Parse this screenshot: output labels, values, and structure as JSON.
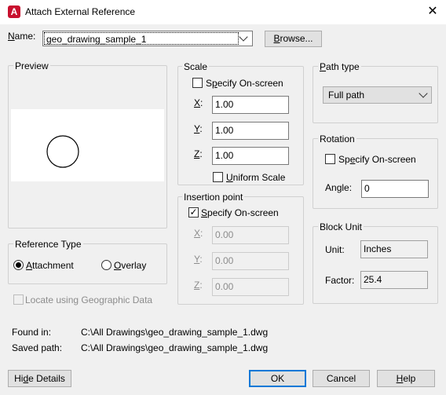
{
  "window": {
    "title": "Attach External Reference",
    "app_icon_letter": "A"
  },
  "name_row": {
    "label": "Name:",
    "value": "geo_drawing_sample_1",
    "browse_label": "Browse..."
  },
  "preview": {
    "label": "Preview"
  },
  "scale": {
    "label": "Scale",
    "specify_label": "Specify On-screen",
    "x_label": "X:",
    "x_value": "1.00",
    "y_label": "Y:",
    "y_value": "1.00",
    "z_label": "Z:",
    "z_value": "1.00",
    "uniform_label": "Uniform Scale"
  },
  "insertion": {
    "label": "Insertion point",
    "specify_label": "Specify On-screen",
    "x_label": "X:",
    "x_value": "0.00",
    "y_label": "Y:",
    "y_value": "0.00",
    "z_label": "Z:",
    "z_value": "0.00"
  },
  "path_type": {
    "label": "Path type",
    "value": "Full path"
  },
  "rotation": {
    "label": "Rotation",
    "specify_label": "Specify On-screen",
    "angle_label": "Angle:",
    "angle_value": "0"
  },
  "block_unit": {
    "label": "Block Unit",
    "unit_label": "Unit:",
    "unit_value": "Inches",
    "factor_label": "Factor:",
    "factor_value": "25.4"
  },
  "reference_type": {
    "label": "Reference Type",
    "attachment_label": "Attachment",
    "overlay_label": "Overlay",
    "selected": "Attachment"
  },
  "geo": {
    "label": "Locate using Geographic Data"
  },
  "details": {
    "found_in_label": "Found in:",
    "found_in_value": "C:\\All Drawings\\geo_drawing_sample_1.dwg",
    "saved_path_label": "Saved path:",
    "saved_path_value": "C:\\All Drawings\\geo_drawing_sample_1.dwg"
  },
  "buttons": {
    "hide_details": "Hide Details",
    "ok": "OK",
    "cancel": "Cancel",
    "help": "Help"
  },
  "icons": {
    "close": "close-icon",
    "check": "check-icon",
    "dropdown": "chevron-down-icon",
    "circle": "preview-circle"
  }
}
